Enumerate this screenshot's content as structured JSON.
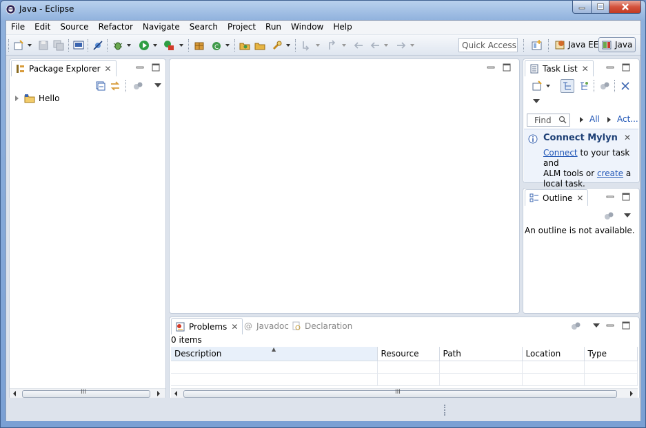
{
  "window": {
    "title": "Java - Eclipse"
  },
  "menu": [
    "File",
    "Edit",
    "Source",
    "Refactor",
    "Navigate",
    "Search",
    "Project",
    "Run",
    "Window",
    "Help"
  ],
  "toolbar": {
    "quick_access": "Quick Access"
  },
  "perspectives": {
    "java_ee": "Java EE",
    "java": "Java"
  },
  "package_explorer": {
    "tab": "Package Explorer",
    "project": "Hello"
  },
  "task_list": {
    "tab": "Task List",
    "find_placeholder": "Find",
    "all": "All",
    "activate": "Act...",
    "mylyn": {
      "title": "Connect Mylyn",
      "connect_link": "Connect",
      "text1": " to your task and",
      "text2": "ALM tools or ",
      "create_link": "create",
      "text3": " a",
      "text4": "local task."
    }
  },
  "outline": {
    "tab": "Outline",
    "message": "An outline is not available."
  },
  "bottom": {
    "tabs": {
      "problems": "Problems",
      "javadoc": "Javadoc",
      "declaration": "Declaration"
    },
    "items": "0 items",
    "columns": [
      "Description",
      "Resource",
      "Path",
      "Location",
      "Type"
    ],
    "scroll_grip": "III"
  },
  "colors": {
    "accent": "#1f55b6",
    "title_gradient_top": "#b9d1ee",
    "panel_border": "#c3cddb"
  }
}
